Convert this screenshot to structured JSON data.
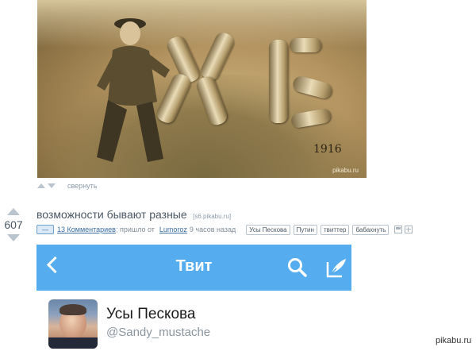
{
  "photo": {
    "year_text": "1916",
    "watermark": "pikabu.ru",
    "collapse_label": "свернуть"
  },
  "post": {
    "rating": "607",
    "title": "возможности бывают разные",
    "source": "[s6.pikabu.ru]",
    "comment_badge": "—",
    "comments_link": "13 Комментариев",
    "meta_prefix": "; пришло от",
    "author": "Lumoroz",
    "time_ago": "9 часов назад",
    "tags": [
      "Усы Пескова",
      "Путин",
      "твиттер",
      "бабахнуть"
    ]
  },
  "tweet_header": {
    "title": "Твит",
    "accent_color": "#55acee"
  },
  "profile": {
    "name": "Усы Пескова",
    "handle": "@Sandy_mustache"
  },
  "site_watermark": "pikabu.ru"
}
